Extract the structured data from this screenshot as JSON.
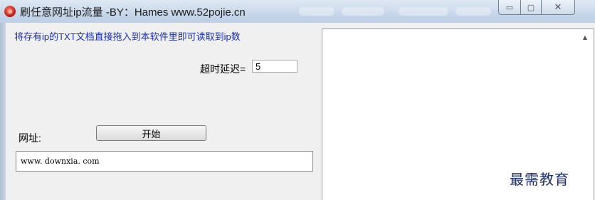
{
  "window": {
    "title": "刷任意网址ip流量  -BY：Hames www.52pojie.cn",
    "icon": "red-sphere-app-icon",
    "controls": {
      "minimize_icon": "▭",
      "maximize_icon": "▢",
      "close_icon": "✕"
    }
  },
  "main": {
    "instruction": "将存有ip的TXT文档直接拖入到本软件里即可读取到ip数",
    "timeout_label": "超时延迟=",
    "timeout_value": "5",
    "url_label": "网址:",
    "start_button": "开始",
    "url_value": "www. downxia. com"
  },
  "ip_list": {
    "scroll_up_icon": "▲",
    "items": []
  },
  "watermark": "最需教育",
  "colors": {
    "instruction_text": "#1a2fc0",
    "title_bar": "#c7d7ea",
    "client_bg": "#f0f0f0"
  }
}
